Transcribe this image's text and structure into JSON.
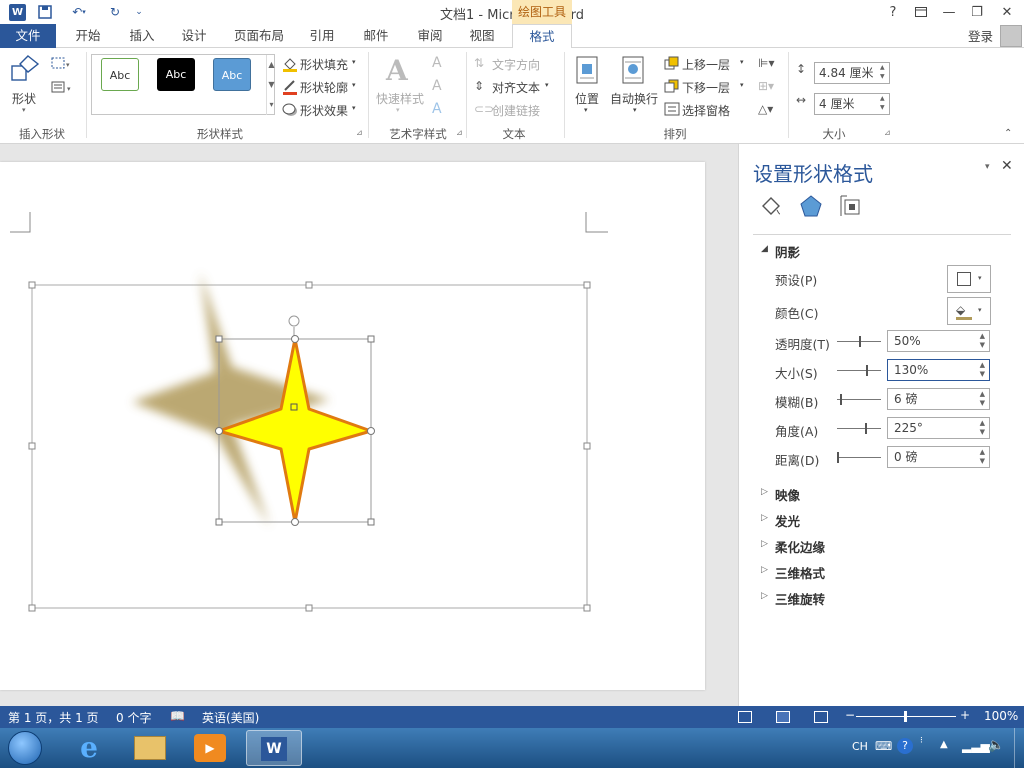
{
  "title_bar": {
    "doc_title": "文档1 - Microsoft Word",
    "context_tab_group": "绘图工具",
    "help": "?",
    "min": "—",
    "restore": "❐",
    "close": "✕"
  },
  "tabs": {
    "file": "文件",
    "items": [
      "开始",
      "插入",
      "设计",
      "页面布局",
      "引用",
      "邮件",
      "审阅",
      "视图"
    ],
    "active": "格式",
    "login": "登录"
  },
  "ribbon": {
    "insert_shape": {
      "shapes": "形状",
      "group": "插入形状"
    },
    "shape_styles": {
      "abc": [
        "Abc",
        "Abc",
        "Abc"
      ],
      "fill": "形状填充",
      "outline": "形状轮廓",
      "effects": "形状效果",
      "group": "形状样式"
    },
    "wordart": {
      "quick_styles": "快速样式",
      "group": "艺术字样式"
    },
    "text": {
      "direction": "文字方向",
      "align": "对齐文本",
      "link": "创建链接",
      "group": "文本"
    },
    "arrange": {
      "position": "位置",
      "wrap": "自动换行",
      "bring_forward": "上移一层",
      "send_backward": "下移一层",
      "selection_pane": "选择窗格",
      "group": "排列"
    },
    "size": {
      "height": "4.84 厘米",
      "width": "4 厘米",
      "group": "大小"
    }
  },
  "pane": {
    "title": "设置形状格式",
    "section_shadow": "阴影",
    "preset": "预设(P)",
    "color": "颜色(C)",
    "transparency": {
      "label": "透明度(T)",
      "value": "50%",
      "level": 0.5
    },
    "size": {
      "label": "大小(S)",
      "value": "130%",
      "level": 0.65
    },
    "blur": {
      "label": "模糊(B)",
      "value": "6 磅",
      "level": 0.06
    },
    "angle": {
      "label": "角度(A)",
      "value": "225°",
      "level": 0.625
    },
    "distance": {
      "label": "距离(D)",
      "value": "0 磅",
      "level": 0.0
    },
    "sections": [
      "映像",
      "发光",
      "柔化边缘",
      "三维格式",
      "三维旋转"
    ]
  },
  "status": {
    "page": "第 1 页，共 1 页",
    "words": "0 个字",
    "language": "英语(美国)",
    "zoom": "100%"
  },
  "taskbar": {
    "ime": "CH"
  },
  "colors": {
    "accent": "#2b579a",
    "star_fill": "#ffff00",
    "star_stroke": "#e07a10",
    "shadow": "#b09a5a"
  }
}
